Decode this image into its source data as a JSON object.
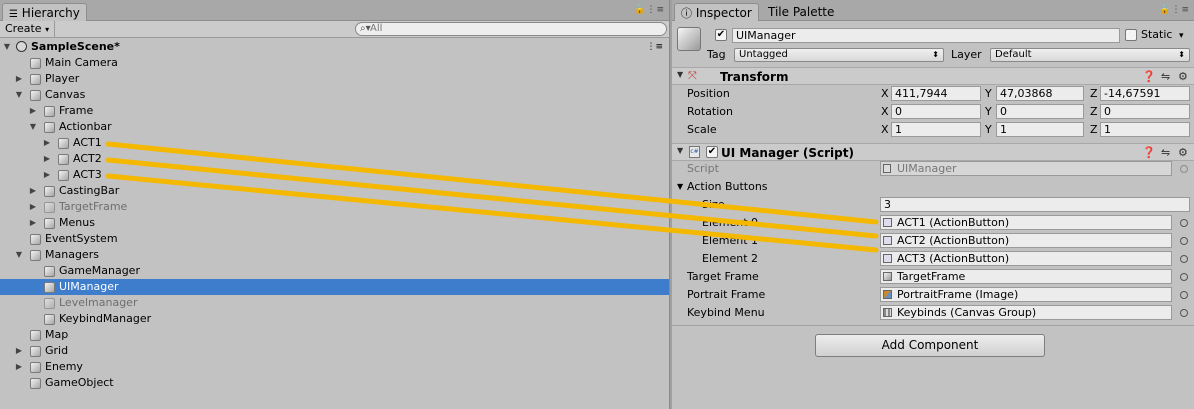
{
  "hierarchy": {
    "tab_label": "Hierarchy",
    "create_label": "Create",
    "search_placeholder": "All",
    "scene_name": "SampleScene*",
    "items": [
      {
        "label": "Main Camera"
      },
      {
        "label": "Player"
      },
      {
        "label": "Canvas"
      },
      {
        "label": "Frame"
      },
      {
        "label": "Actionbar"
      },
      {
        "label": "ACT1"
      },
      {
        "label": "ACT2"
      },
      {
        "label": "ACT3"
      },
      {
        "label": "CastingBar"
      },
      {
        "label": "TargetFrame"
      },
      {
        "label": "Menus"
      },
      {
        "label": "EventSystem"
      },
      {
        "label": "Managers"
      },
      {
        "label": "GameManager"
      },
      {
        "label": "UIManager"
      },
      {
        "label": "Levelmanager"
      },
      {
        "label": "KeybindManager"
      },
      {
        "label": "Map"
      },
      {
        "label": "Grid"
      },
      {
        "label": "Enemy"
      },
      {
        "label": "GameObject"
      }
    ]
  },
  "inspector": {
    "tab_label": "Inspector",
    "tab2_label": "Tile Palette",
    "object_name": "UIManager",
    "static_label": "Static",
    "tag_label": "Tag",
    "tag_value": "Untagged",
    "layer_label": "Layer",
    "layer_value": "Default",
    "transform": {
      "title": "Transform",
      "position_label": "Position",
      "rotation_label": "Rotation",
      "scale_label": "Scale",
      "x": "X",
      "y": "Y",
      "z": "Z",
      "position": [
        "411,7944",
        "47,03868",
        "-14,67591"
      ],
      "rotation": [
        "0",
        "0",
        "0"
      ],
      "scale": [
        "1",
        "1",
        "1"
      ]
    },
    "ui_manager": {
      "title": "UI Manager (Script)",
      "script_label": "Script",
      "script_value": "UIManager",
      "action_buttons_label": "Action Buttons",
      "size_label": "Size",
      "size_value": "3",
      "elements": [
        {
          "label": "Element 0",
          "value": "ACT1 (ActionButton)"
        },
        {
          "label": "Element 1",
          "value": "ACT2 (ActionButton)"
        },
        {
          "label": "Element 2",
          "value": "ACT3 (ActionButton)"
        }
      ],
      "target_frame_label": "Target Frame",
      "target_frame_value": "TargetFrame",
      "portrait_frame_label": "Portrait Frame",
      "portrait_frame_value": "PortraitFrame (Image)",
      "keybind_menu_label": "Keybind Menu",
      "keybind_menu_value": "Keybinds (Canvas Group)"
    },
    "add_component_label": "Add Component"
  },
  "colors": {
    "selection": "#3e7ccc",
    "annotation_line": "#f5b800",
    "panel": "#c2c2c2"
  }
}
